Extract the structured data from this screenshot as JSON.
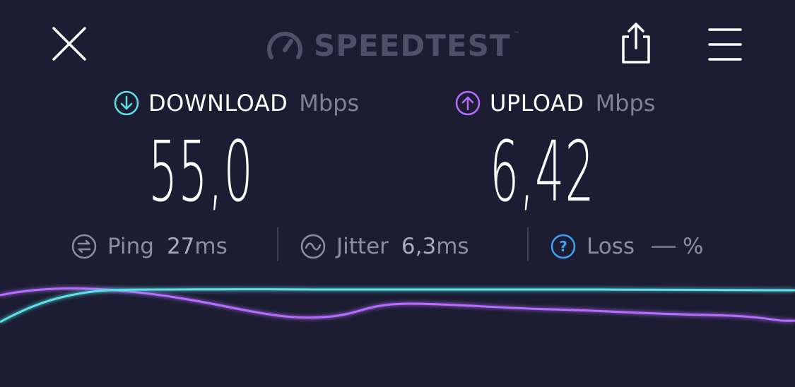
{
  "header": {
    "logo_text": "SPEEDTEST",
    "logo_mark": "™",
    "close_icon": "close-icon",
    "share_icon": "share-icon",
    "menu_icon": "hamburger-menu-icon"
  },
  "download": {
    "label": "DOWNLOAD",
    "unit": "Mbps",
    "value": "55,0",
    "color": "#5ce1e6"
  },
  "upload": {
    "label": "UPLOAD",
    "unit": "Mbps",
    "value": "6,42",
    "color": "#b66dff"
  },
  "stats": {
    "ping": {
      "label": "Ping",
      "value": "27",
      "unit": "ms"
    },
    "jitter": {
      "label": "Jitter",
      "value": "6,3",
      "unit": "ms"
    },
    "loss": {
      "label": "Loss",
      "unit": "%"
    }
  },
  "colors": {
    "background": "#1c1d32",
    "loss_icon": "#3aa3f3",
    "muted_text": "#8b8da2"
  }
}
